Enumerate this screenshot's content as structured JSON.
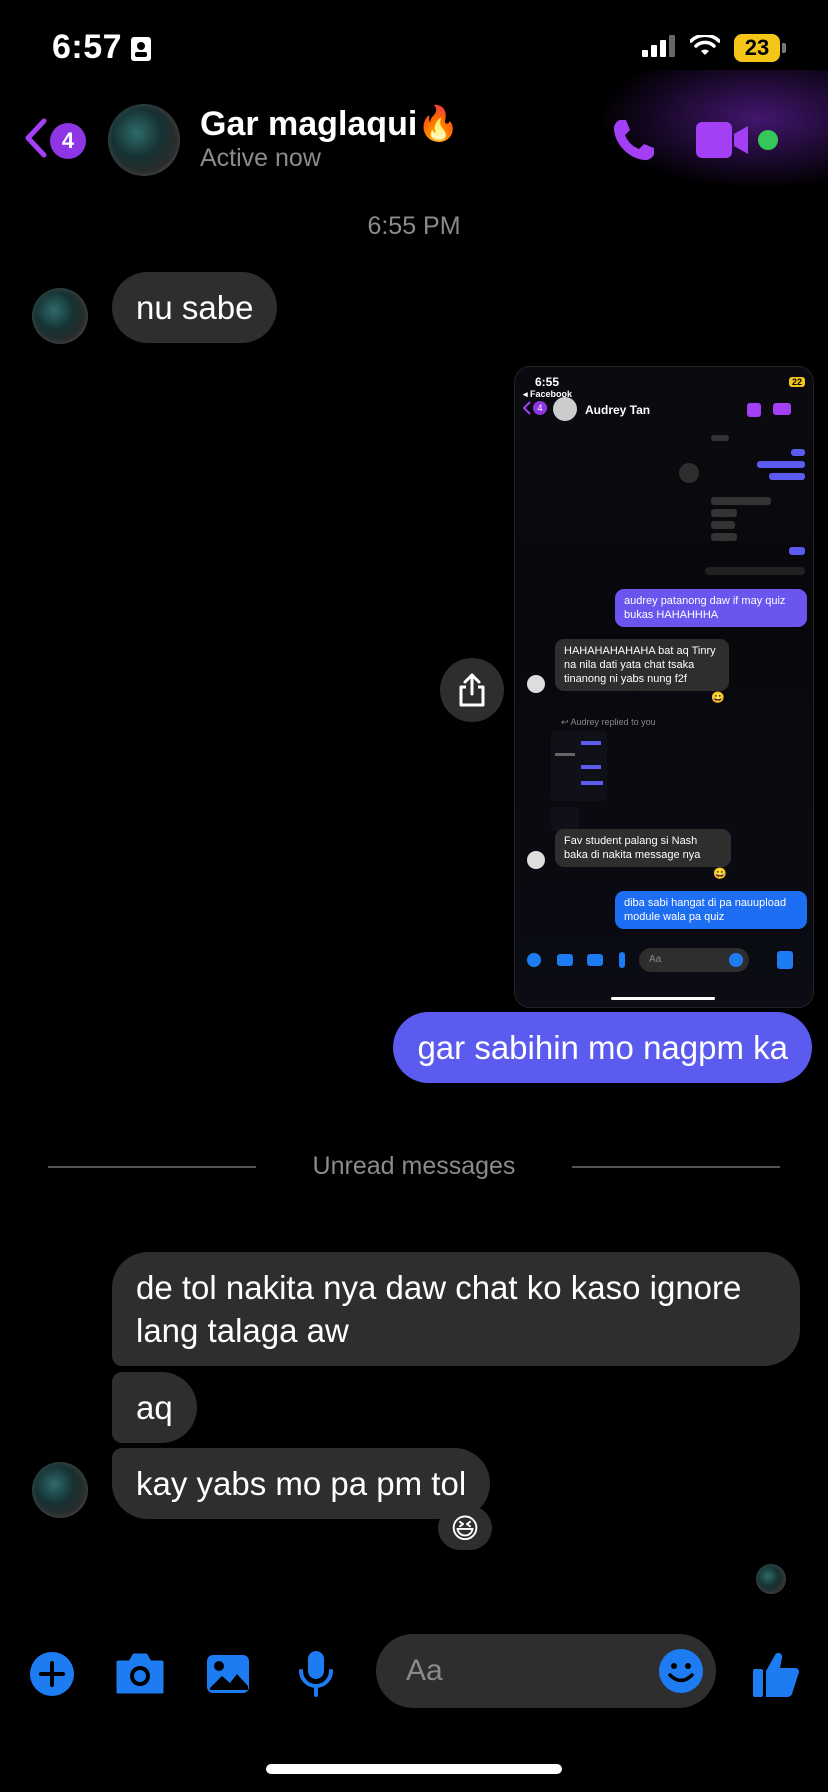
{
  "status_bar": {
    "time": "6:57",
    "battery": "23"
  },
  "header": {
    "back_count": "4",
    "contact_name": "Gar maglaqui🔥",
    "status": "Active now"
  },
  "conversation": {
    "timestamp": "6:55 PM",
    "msg_1": "nu sabe",
    "msg_2": "gar sabihin mo nagpm ka",
    "unread_label": "Unread messages",
    "msg_3": "de tol nakita nya daw chat ko kaso ignore lang talaga aw",
    "msg_4": "aq",
    "msg_5": "kay yabs mo pa pm tol",
    "reaction": "😆"
  },
  "shared_screenshot": {
    "time": "6:55",
    "back_app": "◂ Facebook",
    "back_count": "4",
    "battery": "22",
    "contact": "Audrey Tan",
    "m1": "audrey patanong daw if may quiz bukas HAHAHHHA",
    "m2": "HAHAHAHAHAHA bat aq Tinry na nila dati yata chat tsaka tinanong ni yabs nung f2f",
    "replied": "↩ Audrey replied to you",
    "m3": "Fav student palang si Nash baka di nakita message nya",
    "m4": "diba sabi hangat di pa nauupload module wala pa quiz",
    "placeholder": "Aa"
  },
  "composer": {
    "placeholder": "Aa"
  },
  "colors": {
    "accent": "#a33ff5",
    "outgoing": "#5b5bf0",
    "incoming": "#2e2e2e",
    "composer_icons": "#1e7cf2"
  }
}
